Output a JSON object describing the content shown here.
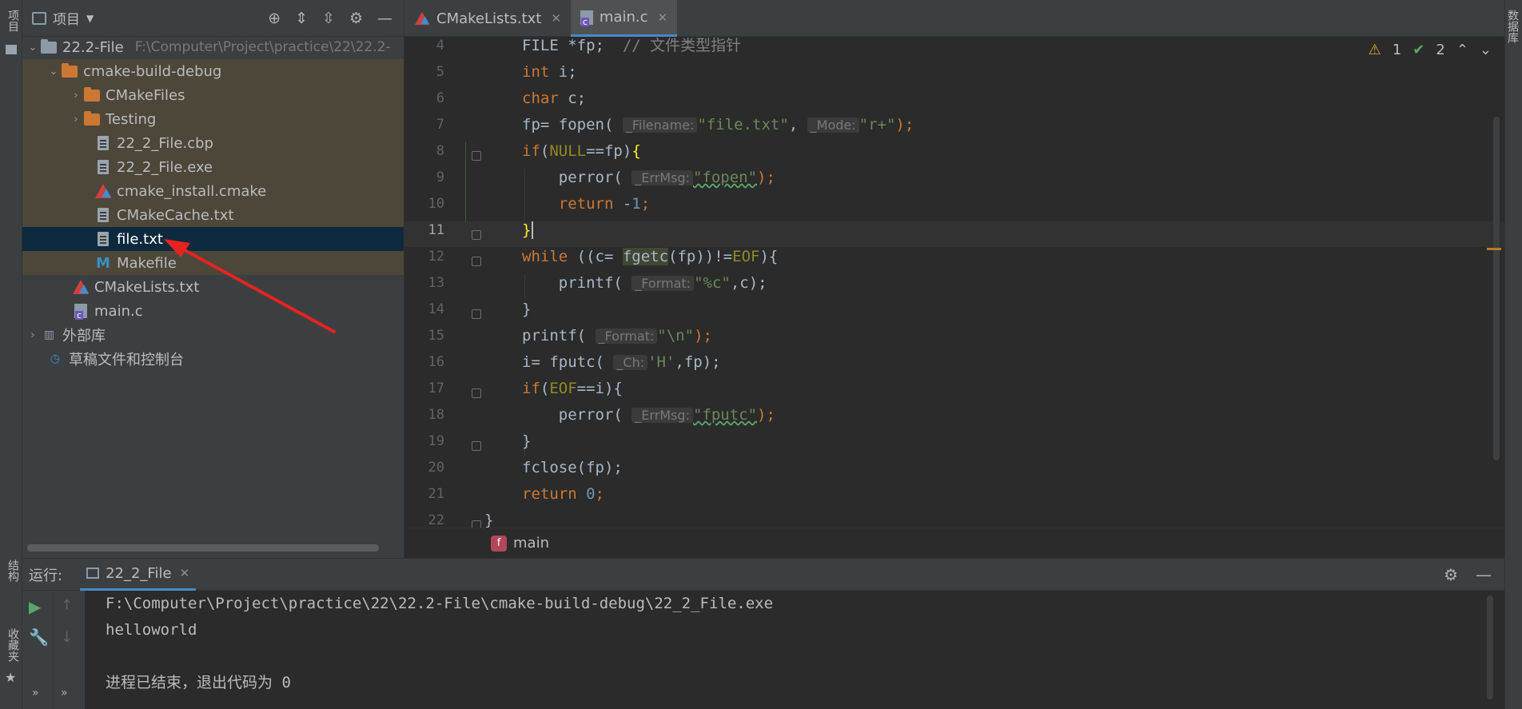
{
  "left_strip": {
    "project_tab": "项目",
    "structure_tab": "结构",
    "favorites_tab": "收藏夹"
  },
  "right_strip": {
    "database_tab": "数据库"
  },
  "project_panel": {
    "title": "项目",
    "tree": [
      {
        "label": "22.2-File",
        "path": "F:\\Computer\\Project\\practice\\22\\22.2-",
        "icon": "folder-icon"
      },
      {
        "label": "cmake-build-debug",
        "icon": "folder-icon"
      },
      {
        "label": "CMakeFiles",
        "icon": "folder-icon"
      },
      {
        "label": "Testing",
        "icon": "folder-icon"
      },
      {
        "label": "22_2_File.cbp",
        "icon": "file-icon"
      },
      {
        "label": "22_2_File.exe",
        "icon": "file-icon"
      },
      {
        "label": "cmake_install.cmake",
        "icon": "cmake-icon"
      },
      {
        "label": "CMakeCache.txt",
        "icon": "file-icon"
      },
      {
        "label": "file.txt",
        "icon": "text-file-icon"
      },
      {
        "label": "Makefile",
        "icon": "makefile-icon"
      },
      {
        "label": "CMakeLists.txt",
        "icon": "cmake-icon"
      },
      {
        "label": "main.c",
        "icon": "c-file-icon"
      },
      {
        "label": "外部库",
        "icon": "library-icon"
      },
      {
        "label": "草稿文件和控制台",
        "icon": "scratch-icon"
      }
    ]
  },
  "tabs": [
    {
      "label": "CMakeLists.txt",
      "icon": "cmake-icon"
    },
    {
      "label": "main.c",
      "icon": "c-file-icon"
    }
  ],
  "inspections": {
    "warnings": "1",
    "weak_warnings": "2"
  },
  "editor": {
    "line_numbers": [
      "4",
      "5",
      "6",
      "7",
      "8",
      "9",
      "10",
      "11",
      "12",
      "13",
      "14",
      "15",
      "16",
      "17",
      "18",
      "19",
      "20",
      "21",
      "22"
    ],
    "current_line": "11",
    "code": {
      "l4a": "FILE *fp;  ",
      "l4b": "// 文件类型指针",
      "l5a": "int",
      "l5b": " i;",
      "l6a": "char",
      "l6b": " c;",
      "l7a": "fp= fopen( ",
      "l7h1": "_Filename:",
      "l7s1": "\"file.txt\"",
      "l7c": ", ",
      "l7h2": "_Mode:",
      "l7s2": "\"r+\"",
      "l7d": ");",
      "l8a": "if",
      "l8b": "(",
      "l8c": "NULL",
      "l8d": "==fp)",
      "l8e": "{",
      "l9a": "    perror( ",
      "l9h": "_ErrMsg:",
      "l9s": "\"fopen\"",
      "l9d": ");",
      "l10a": "    ",
      "l10b": "return",
      "l10c": " -",
      "l10d": "1",
      "l10e": ";",
      "l11a": "}",
      "l12a": "while",
      "l12b": " ((c= ",
      "l12c": "fgetc",
      "l12d": "(fp))!=",
      "l12e": "EOF",
      "l12f": "){",
      "l13a": "    printf( ",
      "l13h": "_Format:",
      "l13s": "\"%c\"",
      "l13d": ",c);",
      "l14a": "}",
      "l15a": "printf( ",
      "l15h": "_Format:",
      "l15s": "\"\\n\"",
      "l15d": ");",
      "l16a": "i= fputc( ",
      "l16h": "_Ch:",
      "l16s": "'H'",
      "l16d": ",fp);",
      "l17a": "if",
      "l17b": "(",
      "l17c": "EOF",
      "l17d": "==i){",
      "l18a": "    perror( ",
      "l18h": "_ErrMsg:",
      "l18s": "\"fputc\"",
      "l18d": ");",
      "l19a": "}",
      "l20a": "fclose(fp);",
      "l21a": "return",
      "l21b": " ",
      "l21c": "0",
      "l21d": ";",
      "l22a": "}"
    }
  },
  "breadcrumb": {
    "badge": "f",
    "label": "main"
  },
  "run_panel": {
    "label": "运行:",
    "tab": "22_2_File",
    "console": [
      "F:\\Computer\\Project\\practice\\22\\22.2-File\\cmake-build-debug\\22_2_File.exe",
      "helloworld",
      "",
      "进程已结束，退出代码为 0"
    ]
  },
  "colors": {
    "accent": "#4a88c7",
    "annotation": "#e8231f",
    "keyword": "#cc7832",
    "string": "#6a8759",
    "number": "#6897bb"
  }
}
